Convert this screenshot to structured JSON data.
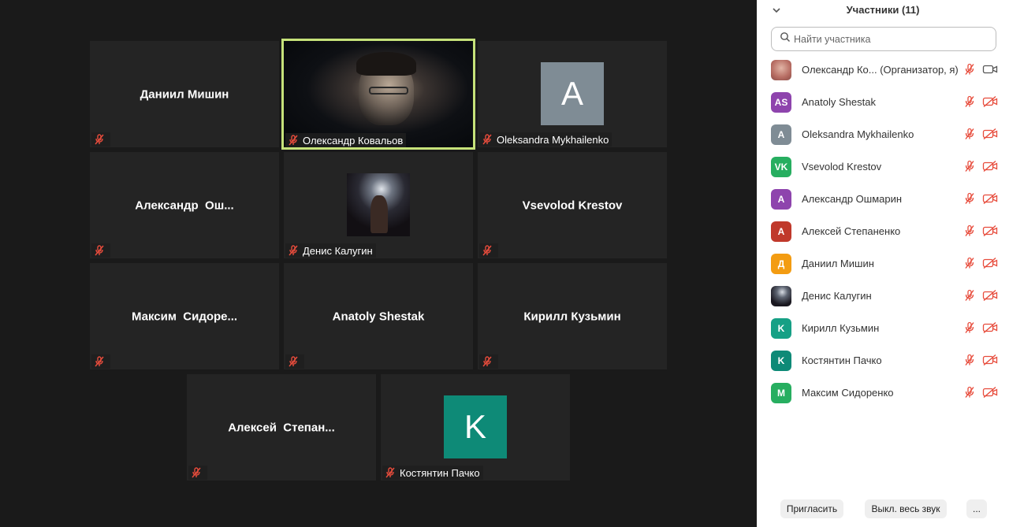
{
  "gallery": {
    "tiles": [
      {
        "name": "Даниил Мишин",
        "label": ""
      },
      {
        "name": "",
        "label": "Олександр Ковальов"
      },
      {
        "name": "",
        "label": "Oleksandra Mykhailenko",
        "avatar_letter": "A"
      },
      {
        "name": "Александр  Ош...",
        "label": ""
      },
      {
        "name": "",
        "label": "Денис Калугин"
      },
      {
        "name": "Vsevolod Krestov",
        "label": ""
      },
      {
        "name": "Максим  Сидоре...",
        "label": ""
      },
      {
        "name": "Anatoly Shestak",
        "label": ""
      },
      {
        "name": "Кирилл Кузьмин",
        "label": ""
      },
      {
        "name": "Алексей  Степан...",
        "label": ""
      },
      {
        "name": "",
        "label": "Костянтин Пачко",
        "avatar_letter": "K"
      }
    ]
  },
  "sidebar": {
    "title": "Участники (11)",
    "search_placeholder": "Найти участника",
    "participants": [
      {
        "avatar": "",
        "name": "Олександр Ко...   (Организатор, я)",
        "color": "#c98a80"
      },
      {
        "avatar": "AS",
        "name": "Anatoly Shestak",
        "color": "#8e44ad"
      },
      {
        "avatar": "A",
        "name": "Oleksandra Mykhailenko",
        "color": "#7f8c95"
      },
      {
        "avatar": "VK",
        "name": "Vsevolod Krestov",
        "color": "#27ae60"
      },
      {
        "avatar": "A",
        "name": "Александр Ошмарин",
        "color": "#8e44ad"
      },
      {
        "avatar": "A",
        "name": "Алексей Степаненко",
        "color": "#c0392b"
      },
      {
        "avatar": "Д",
        "name": "Даниил Мишин",
        "color": "#f39c12"
      },
      {
        "avatar": "",
        "name": "Денис Калугин",
        "color": "#2a2a33"
      },
      {
        "avatar": "K",
        "name": "Кирилл Кузьмин",
        "color": "#16a085"
      },
      {
        "avatar": "K",
        "name": "Костянтин Пачко",
        "color": "#0e8a77"
      },
      {
        "avatar": "M",
        "name": "Максим Сидоренко",
        "color": "#27ae60"
      }
    ]
  },
  "footer": {
    "invite": "Пригласить",
    "mute_all": "Выкл. весь звук",
    "more": "..."
  },
  "colors": {
    "active_speaker_border": "#c6e27a",
    "muted_icon": "#e74c3c",
    "avatar_blue_grey": "#7f8c95",
    "avatar_teal": "#0e8a77"
  }
}
